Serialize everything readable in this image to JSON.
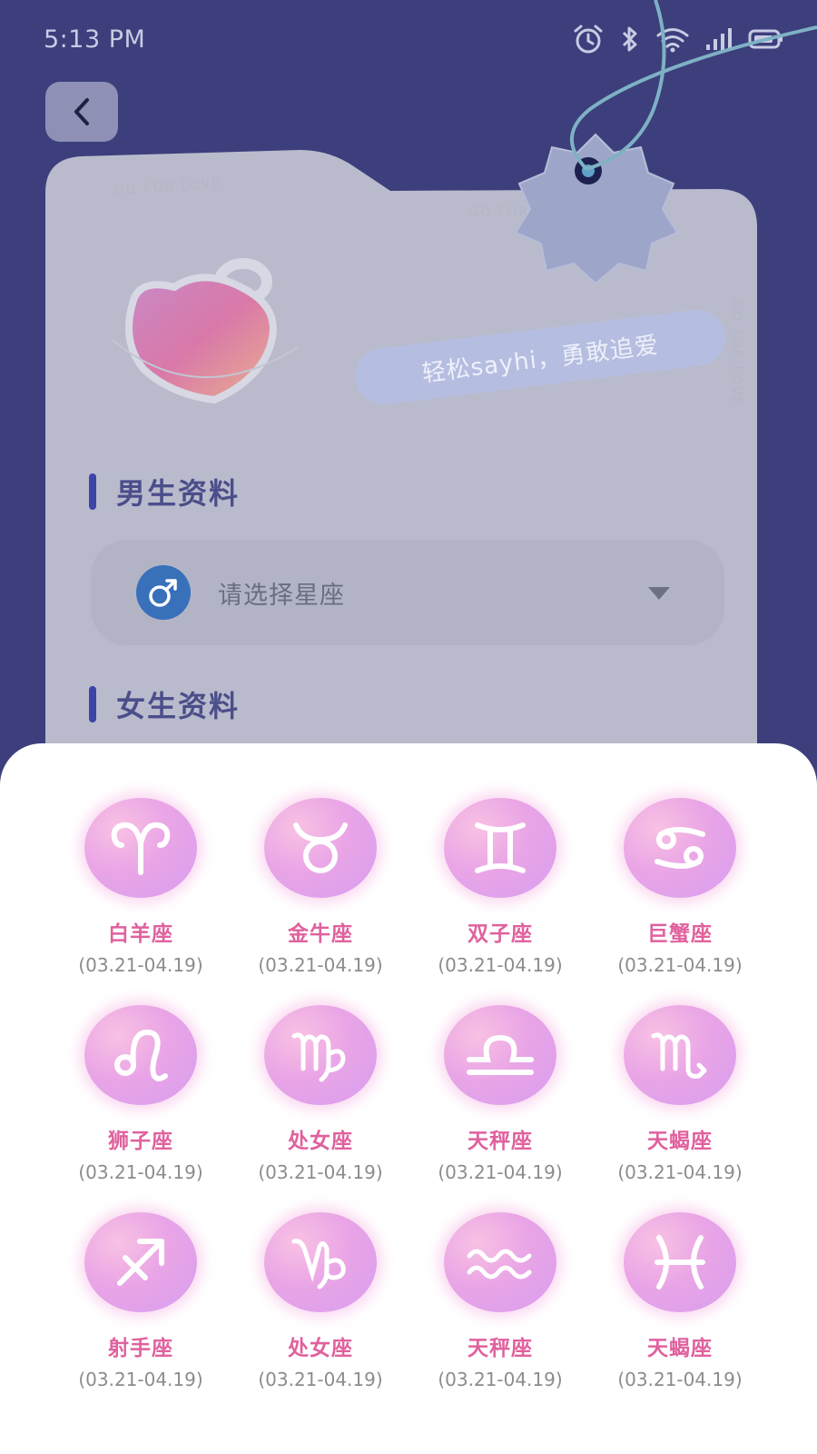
{
  "status_bar": {
    "time": "5:13 PM",
    "icons": [
      "alarm-icon",
      "bluetooth-icon",
      "wifi-icon",
      "signal-icon",
      "battery-icon"
    ]
  },
  "header": {
    "back_icon": "chevron-left-icon"
  },
  "card": {
    "watermark": "GO FOR LOVE",
    "slogan": "轻松sayhi，勇敢追爱",
    "male_section_title": "男生资料",
    "male_select_placeholder": "请选择星座",
    "female_section_title": "女生资料"
  },
  "colors": {
    "background": "#3c3f7c",
    "accent_pink": "#e0619e",
    "male_blue": "#3870ba",
    "section_bar": "#3d43a8"
  },
  "zodiac_sheet": {
    "items": [
      {
        "name": "白羊座",
        "date": "(03.21-04.19)",
        "icon": "aries-icon"
      },
      {
        "name": "金牛座",
        "date": "(03.21-04.19)",
        "icon": "taurus-icon"
      },
      {
        "name": "双子座",
        "date": "(03.21-04.19)",
        "icon": "gemini-icon"
      },
      {
        "name": "巨蟹座",
        "date": "(03.21-04.19)",
        "icon": "cancer-icon"
      },
      {
        "name": "狮子座",
        "date": "(03.21-04.19)",
        "icon": "leo-icon"
      },
      {
        "name": "处女座",
        "date": "(03.21-04.19)",
        "icon": "virgo-icon"
      },
      {
        "name": "天秤座",
        "date": "(03.21-04.19)",
        "icon": "libra-icon"
      },
      {
        "name": "天蝎座",
        "date": "(03.21-04.19)",
        "icon": "scorpio-icon"
      },
      {
        "name": "射手座",
        "date": "(03.21-04.19)",
        "icon": "sagittarius-icon"
      },
      {
        "name": "处女座",
        "date": "(03.21-04.19)",
        "icon": "capricorn-icon"
      },
      {
        "name": "天秤座",
        "date": "(03.21-04.19)",
        "icon": "aquarius-icon"
      },
      {
        "name": "天蝎座",
        "date": "(03.21-04.19)",
        "icon": "pisces-icon"
      }
    ]
  }
}
